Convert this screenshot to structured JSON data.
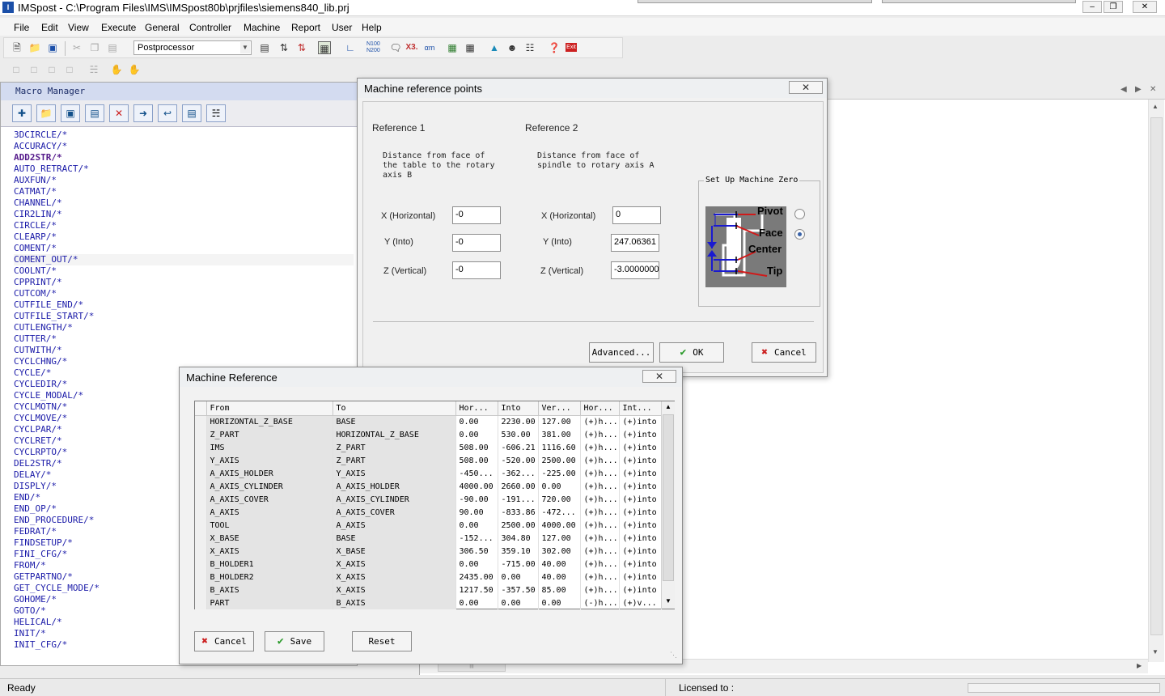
{
  "window": {
    "title": "IMSpost - C:\\Program Files\\IMS\\IMSpost80b\\prjfiles\\siemens840_lib.prj",
    "minimize": "–",
    "restore": "❐",
    "close": "✕"
  },
  "menu": [
    "File",
    "Edit",
    "View",
    "Execute",
    "General",
    "Controller",
    "Machine",
    "Report",
    "User",
    "Help"
  ],
  "toolbar": {
    "combo_value": "Postprocessor",
    "icons": [
      "new-file-icon",
      "open-folder-icon",
      "save-icon",
      "cut-icon",
      "copy-icon",
      "paste-icon",
      "postprocessor-combo",
      "properties-icon",
      "sort-icon",
      "sort-alt-icon",
      "tree-view-icon",
      "graph-icon",
      "n100-icon",
      "balloon-icon",
      "x3-icon",
      "macro-icon",
      "table-icon",
      "grid-icon",
      "wizard-icon",
      "user-icon",
      "tree-icon",
      "help-icon",
      "exit-icon"
    ]
  },
  "macro_manager": {
    "title": "Macro Manager",
    "items": [
      "3DCIRCLE/*",
      "ACCURACY/*",
      "ADD2STR/*",
      "AUTO_RETRACT/*",
      "AUXFUN/*",
      "CATMAT/*",
      "CHANNEL/*",
      "CIR2LIN/*",
      "CIRCLE/*",
      "CLEARP/*",
      "COMENT/*",
      "COMENT_OUT/*",
      "COOLNT/*",
      "CPPRINT/*",
      "CUTCOM/*",
      "CUTFILE_END/*",
      "CUTFILE_START/*",
      "CUTLENGTH/*",
      "CUTTER/*",
      "CUTWITH/*",
      "CYCLCHNG/*",
      "CYCLE/*",
      "CYCLEDIR/*",
      "CYCLE_MODAL/*",
      "CYCLMOTN/*",
      "CYCLMOVE/*",
      "CYCLPAR/*",
      "CYCLRET/*",
      "CYCLRPTO/*",
      "DEL2STR/*",
      "DELAY/*",
      "DISPLY/*",
      "END/*",
      "END_OP/*",
      "END_PROCEDURE/*",
      "FEDRAT/*",
      "FINDSETUP/*",
      "FINI_CFG/*",
      "FROM/*",
      "GETPARTNO/*",
      "GET_CYCLE_MODE/*",
      "GOHOME/*",
      "GOTO/*",
      "HELICAL/*",
      "INIT/*",
      "INIT_CFG/*"
    ],
    "bold_item": "ADD2STR/*",
    "selected_item": "COMENT_OUT/*"
  },
  "ref_points_dialog": {
    "title": "Machine reference points",
    "close": "✕",
    "ref1": {
      "header": "Reference 1",
      "description": "Distance from face of the table to the rotary axis B",
      "x_label": "X (Horizontal)",
      "y_label": "Y (Into)",
      "z_label": "Z (Vertical)",
      "x_value": "-0",
      "y_value": "-0",
      "z_value": "-0"
    },
    "ref2": {
      "header": "Reference 2",
      "description": "Distance from face of spindle to rotary axis A",
      "x_label": "X (Horizontal)",
      "y_label": "Y (Into)",
      "z_label": "Z (Vertical)",
      "x_value": "0",
      "y_value": "247.06361",
      "z_value": "-3.0000000"
    },
    "machine_zero": {
      "legend": "Set Up Machine Zero",
      "pivot": "Pivot",
      "face": "Face",
      "center": "Center",
      "tip": "Tip",
      "selected": "Face"
    },
    "advanced_button": "Advanced...",
    "ok_button": "OK",
    "cancel_button": "Cancel"
  },
  "machine_ref_dialog": {
    "title": "Machine Reference",
    "close": "✕",
    "columns": [
      "From",
      "To",
      "Hor...",
      "Into",
      "Ver...",
      "Hor...",
      "Int..."
    ],
    "rows": [
      [
        "HORIZONTAL_Z_BASE",
        "BASE",
        "0.00",
        "2230.00",
        "127.00",
        "(+)h...",
        "(+)into"
      ],
      [
        "Z_PART",
        "HORIZONTAL_Z_BASE",
        "0.00",
        "530.00",
        "381.00",
        "(+)h...",
        "(+)into"
      ],
      [
        "IMS",
        "Z_PART",
        "508.00",
        "-606.21",
        "1116.60",
        "(+)h...",
        "(+)into"
      ],
      [
        "Y_AXIS",
        "Z_PART",
        "508.00",
        "-520.00",
        "2500.00",
        "(+)h...",
        "(+)into"
      ],
      [
        "A_AXIS_HOLDER",
        "Y_AXIS",
        "-450...",
        "-362...",
        "-225.00",
        "(+)h...",
        "(+)into"
      ],
      [
        "A_AXIS_CYLINDER",
        "A_AXIS_HOLDER",
        "4000.00",
        "2660.00",
        "0.00",
        "(+)h...",
        "(+)into"
      ],
      [
        "A_AXIS_COVER",
        "A_AXIS_CYLINDER",
        "-90.00",
        "-191...",
        "720.00",
        "(+)h...",
        "(+)into"
      ],
      [
        "A_AXIS",
        "A_AXIS_COVER",
        "90.00",
        "-833.86",
        "-472...",
        "(+)h...",
        "(+)into"
      ],
      [
        "TOOL",
        "A_AXIS",
        "0.00",
        "2500.00",
        "4000.00",
        "(+)h...",
        "(+)into"
      ],
      [
        "X_BASE",
        "BASE",
        "-152...",
        "304.80",
        "127.00",
        "(+)h...",
        "(+)into"
      ],
      [
        "X_AXIS",
        "X_BASE",
        "306.50",
        "359.10",
        "302.00",
        "(+)h...",
        "(+)into"
      ],
      [
        "B_HOLDER1",
        "X_AXIS",
        "0.00",
        "-715.00",
        "40.00",
        "(+)h...",
        "(+)into"
      ],
      [
        "B_HOLDER2",
        "X_AXIS",
        "2435.00",
        "0.00",
        "40.00",
        "(+)h...",
        "(+)into"
      ],
      [
        "B_AXIS",
        "X_AXIS",
        "1217.50",
        "-357.50",
        "85.00",
        "(+)h...",
        "(+)into"
      ],
      [
        "PART",
        "B_AXIS",
        "0.00",
        "0.00",
        "0.00",
        "(-)h...",
        "(+)v..."
      ]
    ],
    "cancel_button": "Cancel",
    "save_button": "Save",
    "reset_button": "Reset"
  },
  "status": {
    "ready": "Ready",
    "licensed": "Licensed to :"
  },
  "colors": {
    "macro_text": "#1a1aa8",
    "panel_header": "#d3dbf0",
    "ok_check": "#2a9a2a",
    "cancel_x": "#cc2020",
    "diagram_blue": "#1a1ad0",
    "diagram_red": "#d01a1a"
  }
}
